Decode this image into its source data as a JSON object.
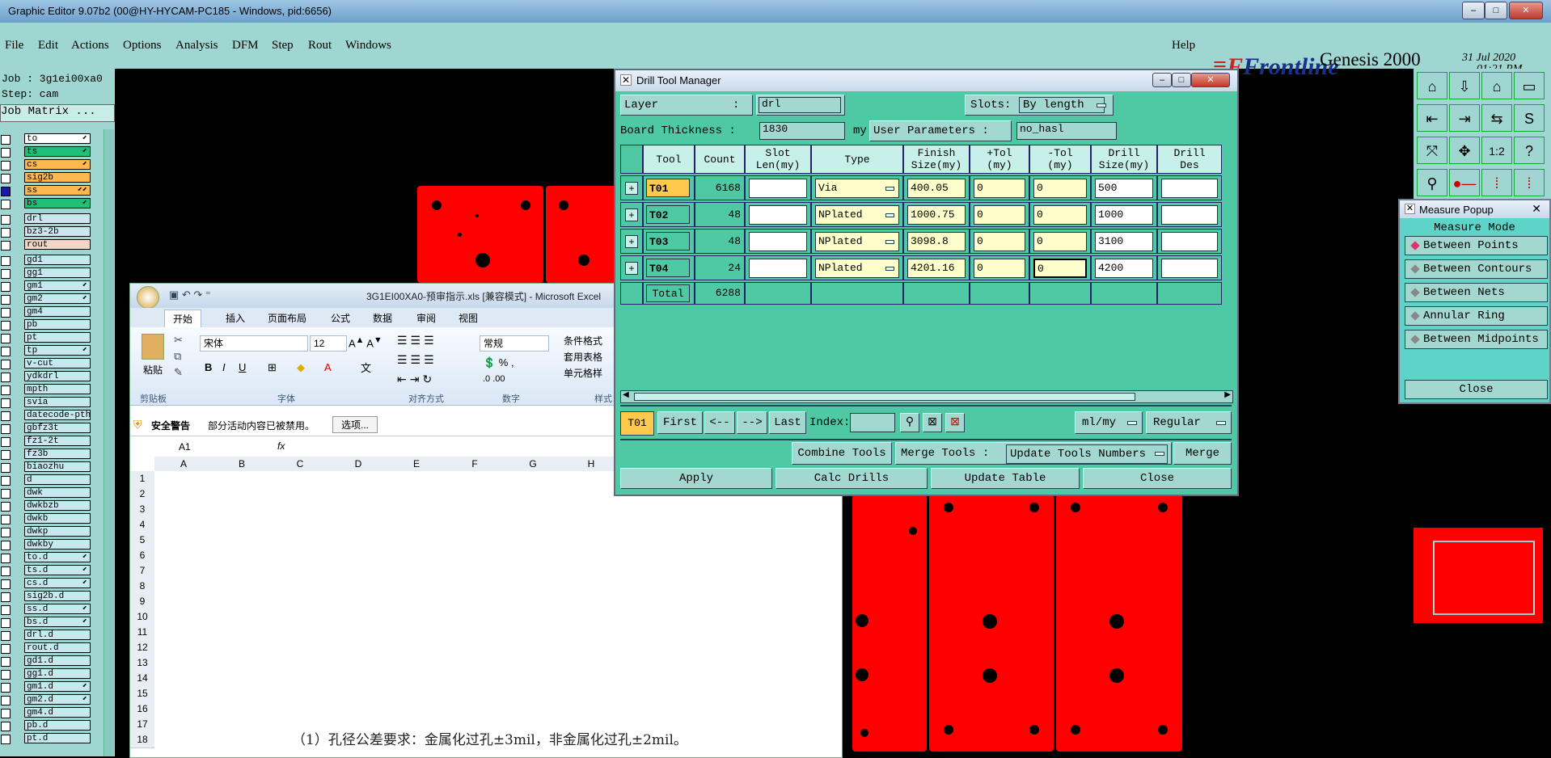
{
  "titlebar": {
    "title": "Graphic Editor 9.07b2 (00@HY-HYCAM-PC185 - Windows, pid:6656)"
  },
  "menubar": {
    "items": [
      "File",
      "Edit",
      "Actions",
      "Options",
      "Analysis",
      "DFM",
      "Step",
      "Rout",
      "Windows"
    ],
    "help": "Help",
    "brand": "Frontline",
    "product": "Genesis 2000",
    "subtitle": "Graphic Editor",
    "date": "31 Jul 2020",
    "time": "01:21 PM"
  },
  "left": {
    "job": "Job : 3g1ei00xa0",
    "step": "Step: cam",
    "job_matrix": "Job Matrix ...",
    "layers": [
      {
        "name": "to",
        "color": "#ffffff",
        "mark": "⬋"
      },
      {
        "name": "ts",
        "color": "#1fbf7a",
        "mark": "⬋"
      },
      {
        "name": "cs",
        "color": "#ffb84d",
        "mark": "⬋"
      },
      {
        "name": "sig2b",
        "color": "#ffb84d",
        "mark": ""
      },
      {
        "name": "ss",
        "color": "#ffb84d",
        "mark": "⬋⬋"
      },
      {
        "name": "bs",
        "color": "#1fbf7a",
        "mark": "⬋"
      },
      {
        "name": "drl",
        "color": "#c8e8f0",
        "mark": ""
      },
      {
        "name": "bz3-2b",
        "color": "#c8e8f0",
        "mark": ""
      },
      {
        "name": "rout",
        "color": "#f2d7c8",
        "mark": ""
      },
      {
        "name": "gd1",
        "color": "#c8e8f0",
        "mark": ""
      },
      {
        "name": "gg1",
        "color": "#c8e8f0",
        "mark": ""
      },
      {
        "name": "gm1",
        "color": "#c8e8f0",
        "mark": "⬋"
      },
      {
        "name": "gm2",
        "color": "#c8e8f0",
        "mark": "⬋"
      },
      {
        "name": "gm4",
        "color": "#c8e8f0",
        "mark": ""
      },
      {
        "name": "pb",
        "color": "#c8e8f0",
        "mark": ""
      },
      {
        "name": "pt",
        "color": "#c8e8f0",
        "mark": ""
      },
      {
        "name": "tp",
        "color": "#c8e8f0",
        "mark": "⬋"
      },
      {
        "name": "v-cut",
        "color": "#c8e8f0",
        "mark": ""
      },
      {
        "name": "ydkdrl",
        "color": "#c8e8f0",
        "mark": ""
      },
      {
        "name": "mpth",
        "color": "#c8e8f0",
        "mark": ""
      },
      {
        "name": "svia",
        "color": "#c8e8f0",
        "mark": ""
      },
      {
        "name": "datecode-pth",
        "color": "#c8e8f0",
        "mark": ""
      },
      {
        "name": "gbfz3t",
        "color": "#c8e8f0",
        "mark": ""
      },
      {
        "name": "fz1-2t",
        "color": "#c8e8f0",
        "mark": ""
      },
      {
        "name": "fz3b",
        "color": "#c8e8f0",
        "mark": ""
      },
      {
        "name": "biaozhu",
        "color": "#c8e8f0",
        "mark": ""
      },
      {
        "name": "d",
        "color": "#c8e8f0",
        "mark": ""
      },
      {
        "name": "dwk",
        "color": "#c8e8f0",
        "mark": ""
      },
      {
        "name": "dwkbzb",
        "color": "#c8e8f0",
        "mark": ""
      },
      {
        "name": "dwkb",
        "color": "#c8e8f0",
        "mark": ""
      },
      {
        "name": "dwkp",
        "color": "#c8e8f0",
        "mark": ""
      },
      {
        "name": "dwkby",
        "color": "#c8e8f0",
        "mark": ""
      },
      {
        "name": "to.d",
        "color": "#c8e8f0",
        "mark": "⬋"
      },
      {
        "name": "ts.d",
        "color": "#c8e8f0",
        "mark": "⬋"
      },
      {
        "name": "cs.d",
        "color": "#c8e8f0",
        "mark": "⬋"
      },
      {
        "name": "sig2b.d",
        "color": "#c8e8f0",
        "mark": ""
      },
      {
        "name": "ss.d",
        "color": "#c8e8f0",
        "mark": "⬋"
      },
      {
        "name": "bs.d",
        "color": "#c8e8f0",
        "mark": "⬋"
      },
      {
        "name": "drl.d",
        "color": "#c8e8f0",
        "mark": ""
      },
      {
        "name": "rout.d",
        "color": "#c8e8f0",
        "mark": ""
      },
      {
        "name": "gd1.d",
        "color": "#c8e8f0",
        "mark": ""
      },
      {
        "name": "gg1.d",
        "color": "#c8e8f0",
        "mark": ""
      },
      {
        "name": "gm1.d",
        "color": "#c8e8f0",
        "mark": "⬋"
      },
      {
        "name": "gm2.d",
        "color": "#c8e8f0",
        "mark": "⬋"
      },
      {
        "name": "gm4.d",
        "color": "#c8e8f0",
        "mark": ""
      },
      {
        "name": "pb.d",
        "color": "#c8e8f0",
        "mark": ""
      },
      {
        "name": "pt.d",
        "color": "#c8e8f0",
        "mark": ""
      }
    ]
  },
  "excel": {
    "title": "3G1EI00XA0-预审指示.xls  [兼容模式] - Microsoft Excel",
    "tabs": [
      "开始",
      "插入",
      "页面布局",
      "公式",
      "数据",
      "审阅",
      "视图"
    ],
    "paste": "粘贴",
    "font_name": "宋体",
    "font_size": "12",
    "number_format": "常规",
    "groups": [
      "剪贴板",
      "字体",
      "对齐方式",
      "数字",
      "样式"
    ],
    "styles": [
      "条件格式",
      "套用表格",
      "单元格样"
    ],
    "warning_label": "安全警告",
    "warning_text": "部分活动内容已被禁用。",
    "options_btn": "选项...",
    "namebox": "A1",
    "fx": "fx",
    "columns": [
      "A",
      "B",
      "C",
      "D",
      "E",
      "F",
      "G",
      "H"
    ],
    "rows": [
      "1",
      "2",
      "3",
      "4",
      "5",
      "6",
      "7",
      "8",
      "9",
      "10",
      "11",
      "12",
      "13",
      "14",
      "15",
      "16",
      "17",
      "18"
    ],
    "note": "（1）孔径公差要求：金属化过孔±3mil，非金属化过孔±2mil。"
  },
  "dtm": {
    "title": "Drill Tool Manager",
    "layer_label": "Layer",
    "layer_colon": ":",
    "layer_value": "drl",
    "slots_label": "Slots:",
    "slots_value": "By length",
    "thickness_label": "Board Thickness :",
    "thickness_value": "1830",
    "thickness_unit": "my",
    "userparams_label": "User Parameters :",
    "userparams_value": "no_hasl",
    "headers": [
      "Tool",
      "Count",
      "Slot\nLen(my)",
      "Type",
      "Finish\nSize(my)",
      "+Tol\n(my)",
      "-Tol\n(my)",
      "Drill\nSize(my)",
      "Drill\nDes"
    ],
    "rows": [
      {
        "tool": "T01",
        "count": "6168",
        "slot": "",
        "type": "Via",
        "finish": "400.05",
        "ptol": "0",
        "ntol": "0",
        "drill": "500",
        "des": ""
      },
      {
        "tool": "T02",
        "count": "48",
        "slot": "",
        "type": "NPlated",
        "finish": "1000.75",
        "ptol": "0",
        "ntol": "0",
        "drill": "1000",
        "des": ""
      },
      {
        "tool": "T03",
        "count": "48",
        "slot": "",
        "type": "NPlated",
        "finish": "3098.8",
        "ptol": "0",
        "ntol": "0",
        "drill": "3100",
        "des": ""
      },
      {
        "tool": "T04",
        "count": "24",
        "slot": "",
        "type": "NPlated",
        "finish": "4201.16",
        "ptol": "0",
        "ntol": "0",
        "drill": "4200",
        "des": ""
      }
    ],
    "total_label": "Total",
    "total_value": "6288",
    "current_tool": "T01",
    "nav": [
      "First",
      "<--",
      "-->",
      "Last"
    ],
    "index_label": "Index:",
    "units": "ml/my",
    "mode": "Regular",
    "combine": "Combine Tools",
    "merge_label": "Merge Tools :",
    "update_numbers": "Update Tools Numbers",
    "merge": "Merge",
    "apply": "Apply",
    "calc": "Calc Drills",
    "update_table": "Update Table",
    "close": "Close"
  },
  "measure": {
    "title": "Measure Popup",
    "mode_label": "Measure Mode",
    "options": [
      "Between Points",
      "Between Contours",
      "Between Nets",
      "Annular Ring",
      "Between Midpoints"
    ],
    "close": "Close"
  }
}
